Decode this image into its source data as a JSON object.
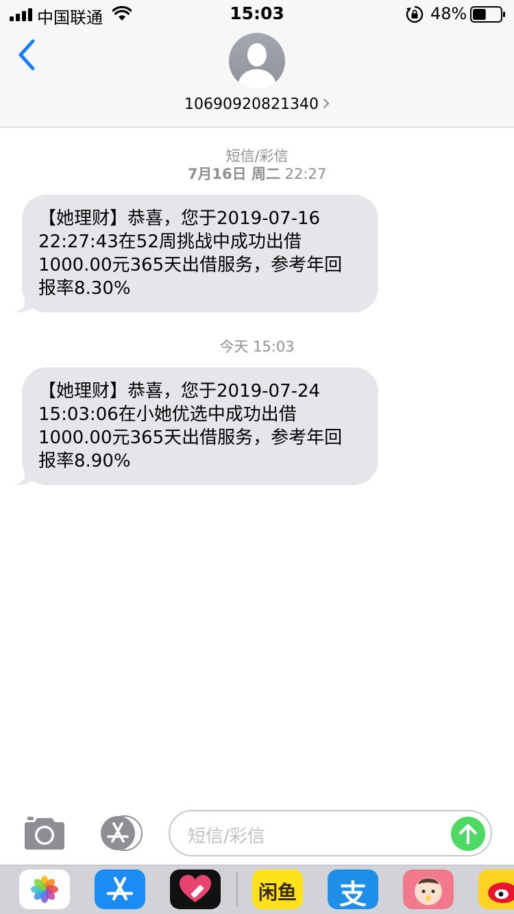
{
  "status_bar": {
    "carrier": "中国联通",
    "time": "15:03",
    "battery_percent": "48%",
    "battery_level": 0.48
  },
  "header": {
    "contact": "10690920821340",
    "back_icon": "chevron-left-icon",
    "avatar_icon": "person-silhouette-icon"
  },
  "thread": {
    "service_label": "短信/彩信",
    "groups": [
      {
        "date_bold": "7月16日 周二",
        "time": "22:27",
        "lines": [
          "【她理财】恭喜，您于2019-07-16",
          "22:27:43在52周挑战中成功出借",
          "1000.00元365天出借服务，参考年回",
          "报率8.30%"
        ]
      },
      {
        "date_bold": "",
        "time": "今天 15:03",
        "lines": [
          "【她理财】恭喜，您于2019-07-24",
          "15:03:06在小她优选中成功出借",
          "1000.00元365天出借服务，参考年回",
          "报率8.90%"
        ]
      }
    ]
  },
  "input": {
    "placeholder": "短信/彩信",
    "send_color": "#4cd964"
  },
  "app_drawer": {
    "apps": [
      {
        "name": "photos-app-icon",
        "color": "#ffffff"
      },
      {
        "name": "app-store-icon",
        "color": "#1b8cf3"
      },
      {
        "name": "heart-app-icon",
        "color": "#111111"
      },
      {
        "name": "xianyu-app-icon",
        "color": "#ffe21a",
        "label": "闲鱼"
      },
      {
        "name": "alipay-app-icon",
        "color": "#1d8fe8",
        "label": "支"
      },
      {
        "name": "baby-app-icon",
        "color": "#f2788c"
      },
      {
        "name": "weibo-app-icon",
        "color": "#ffd324"
      }
    ]
  },
  "colors": {
    "bubble": "#e5e5ea",
    "accent_blue": "#157efb",
    "meta_gray": "#8e8e93"
  }
}
